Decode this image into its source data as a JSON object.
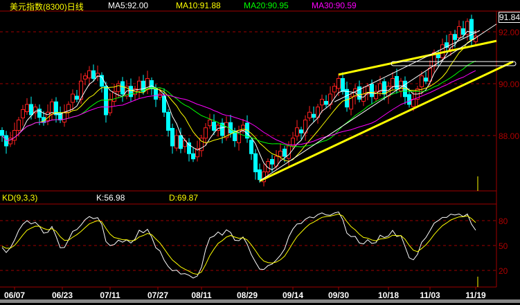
{
  "header": {
    "title": "美元指数(8300)日线",
    "ma5": "MA5:92.00",
    "ma10": "MA10:91.88",
    "ma20": "MA20:90.95",
    "ma30": "MA30:90.59",
    "last_price": "91.84"
  },
  "kd_header": {
    "name": "KD(9,3,3)",
    "k": "K:56.98",
    "d": "D:69.87"
  },
  "colors": {
    "up": "#ff2020",
    "down": "#00ffff",
    "ma5": "#ffffff",
    "ma10": "#ffff00",
    "ma20": "#00ff00",
    "ma30": "#ff00ff",
    "grid": "#a00000",
    "axis_text": "#b00000",
    "trendline": "#ffff00"
  },
  "chart_data": {
    "type": "candlestick",
    "title": "美元指数(8300)日线",
    "price_ylim": [
      85.8,
      93.2
    ],
    "price_ticks": [
      "88.00",
      "90.00",
      "92.00"
    ],
    "kd_ylim": [
      0,
      100
    ],
    "kd_ticks": [
      "20",
      "50",
      "80"
    ],
    "date_labels": [
      {
        "label": "06/07",
        "index": 3
      },
      {
        "label": "06/23",
        "index": 14.5
      },
      {
        "label": "07/11",
        "index": 26
      },
      {
        "label": "07/27",
        "index": 37.5
      },
      {
        "label": "08/11",
        "index": 48
      },
      {
        "label": "08/29",
        "index": 59
      },
      {
        "label": "09/14",
        "index": 70
      },
      {
        "label": "09/30",
        "index": 81
      },
      {
        "label": "10/18",
        "index": 93
      },
      {
        "label": "11/03",
        "index": 103
      },
      {
        "label": "11/19",
        "index": 114
      }
    ],
    "close": [
      88.0,
      87.6,
      87.9,
      88.2,
      88.6,
      89.0,
      89.2,
      88.8,
      89.1,
      88.7,
      88.5,
      88.9,
      89.3,
      88.8,
      88.6,
      88.9,
      89.2,
      89.6,
      89.4,
      90.1,
      90.3,
      90.5,
      90.2,
      90.4,
      89.9,
      88.8,
      89.4,
      89.7,
      90.0,
      89.6,
      89.9,
      89.5,
      89.8,
      90.1,
      89.7,
      90.2,
      89.8,
      89.4,
      89.6,
      88.9,
      88.2,
      87.6,
      88.0,
      87.5,
      87.8,
      87.3,
      87.1,
      87.5,
      87.9,
      88.3,
      88.6,
      88.2,
      88.4,
      88.0,
      88.5,
      88.1,
      87.8,
      88.2,
      88.4,
      87.9,
      87.3,
      86.6,
      86.3,
      86.6,
      87.0,
      86.9,
      87.2,
      87.4,
      87.2,
      87.6,
      87.9,
      88.3,
      88.1,
      88.6,
      88.9,
      88.7,
      89.1,
      89.4,
      89.2,
      89.6,
      89.9,
      90.2,
      89.7,
      89.1,
      89.5,
      89.8,
      89.4,
      89.6,
      89.9,
      89.5,
      89.7,
      90.0,
      89.6,
      89.9,
      90.2,
      89.8,
      90.1,
      89.5,
      89.2,
      89.4,
      89.8,
      90.3,
      90.1,
      90.6,
      91.2,
      91.0,
      91.5,
      91.4,
      91.9,
      91.7,
      92.2,
      91.9,
      92.4,
      91.7,
      91.84
    ],
    "trendlines": [
      {
        "from": [
          62,
          86.25
        ],
        "to": [
          123,
          90.85
        ],
        "width": "thick"
      },
      {
        "from": [
          81,
          90.35
        ],
        "to": [
          119,
          91.65
        ],
        "width": "thick"
      },
      {
        "from": [
          62,
          86.25
        ],
        "to": [
          119,
          92.3
        ],
        "width": "thin"
      },
      {
        "from": [
          80,
          89.3
        ],
        "to": [
          115,
          92.05
        ],
        "width": "thin"
      }
    ]
  }
}
